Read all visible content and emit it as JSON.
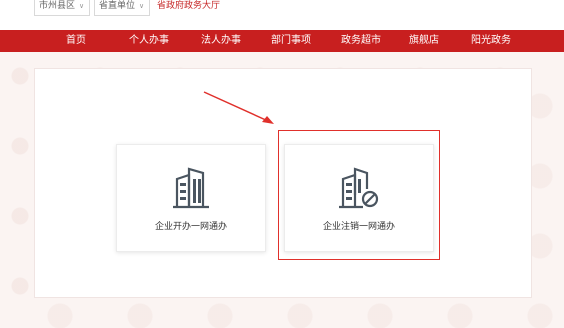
{
  "topbar": {
    "region_label": "市州县区",
    "dept_label": "省直单位",
    "gov_hall_label": "省政府政务大厅"
  },
  "nav": {
    "items": [
      {
        "label": "首页"
      },
      {
        "label": "个人办事"
      },
      {
        "label": "法人办事"
      },
      {
        "label": "部门事项"
      },
      {
        "label": "政务超市"
      },
      {
        "label": "旗舰店"
      },
      {
        "label": "阳光政务"
      }
    ]
  },
  "cards": [
    {
      "label": "企业开办一网通办",
      "icon": "building-icon"
    },
    {
      "label": "企业注销一网通办",
      "icon": "building-cancel-icon"
    }
  ],
  "colors": {
    "brand_red": "#c81f1f",
    "highlight": "#e0302b"
  }
}
